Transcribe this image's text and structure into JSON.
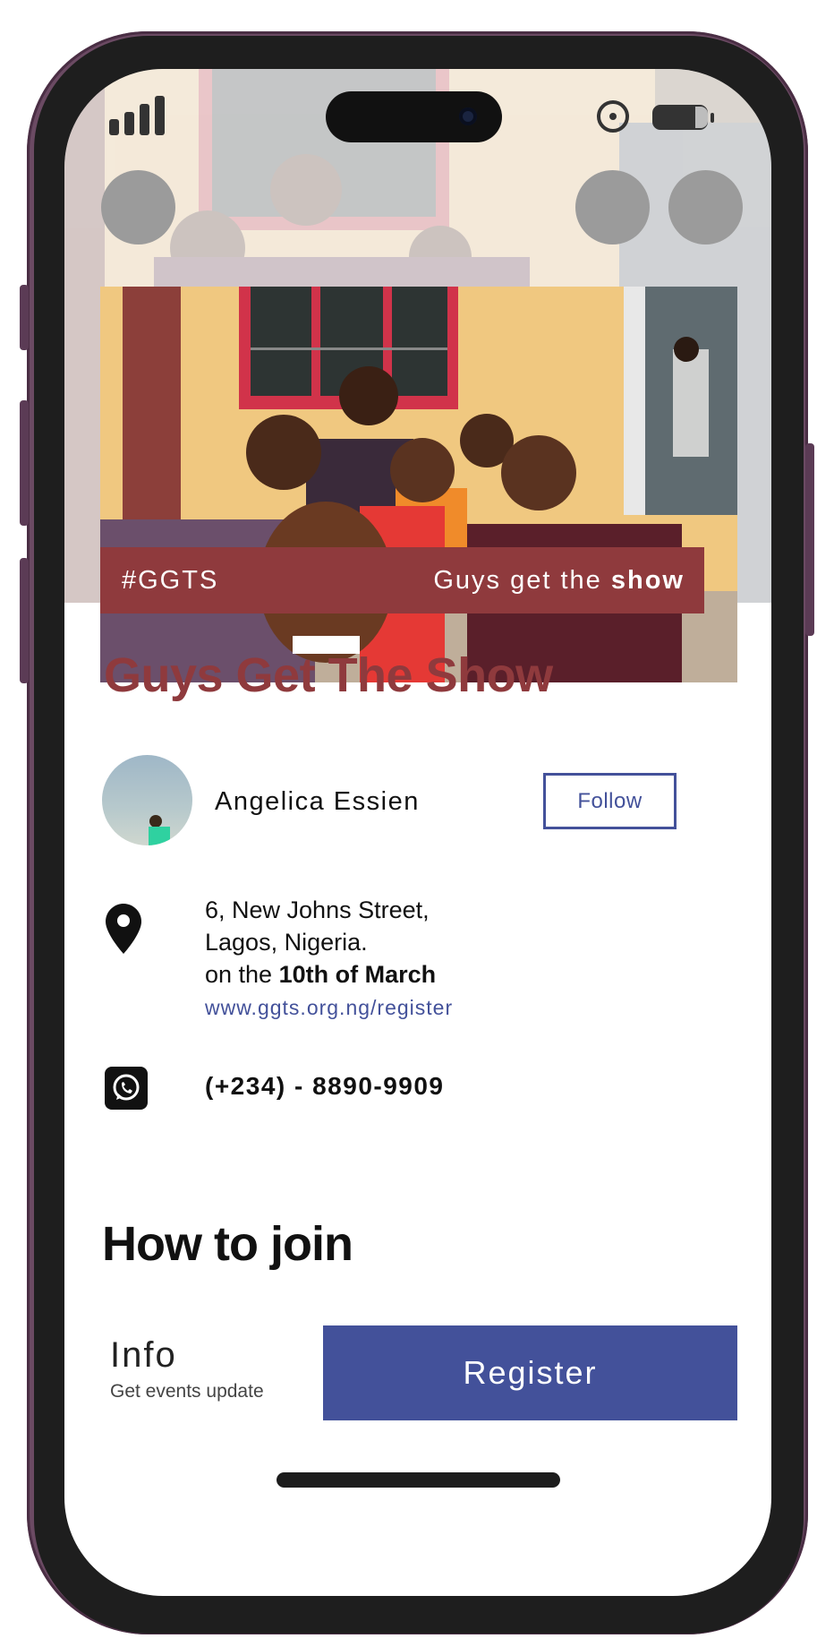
{
  "event": {
    "hashtag": "#GGTS",
    "tagline_prefix": "Guys get the",
    "tagline_bold": "show",
    "title": "Guys Get The Show"
  },
  "host": {
    "name": "Angelica Essien",
    "follow_label": "Follow"
  },
  "location": {
    "line1": "6, New Johns Street,",
    "line2": "Lagos, Nigeria.",
    "date_prefix": "on the",
    "date_bold": "10th of March",
    "link": "www.ggts.org.ng/register"
  },
  "contact": {
    "phone": "(+234) - 8890-9909"
  },
  "join": {
    "heading": "How to join",
    "info_label": "Info",
    "info_sub": "Get events update",
    "register_label": "Register"
  },
  "colors": {
    "brand_red": "#8f3a3d",
    "brand_blue": "#43519a",
    "frame": "#6b4a63"
  }
}
